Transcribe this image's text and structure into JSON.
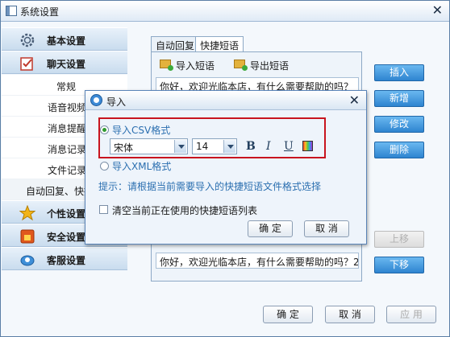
{
  "window": {
    "title": "系统设置"
  },
  "sidebar": {
    "categories": [
      {
        "label": "基本设置",
        "icon": "gear-icon"
      },
      {
        "label": "聊天设置",
        "icon": "chat-settings-icon"
      },
      {
        "label": "个性设置",
        "icon": "star-icon"
      },
      {
        "label": "安全设置",
        "icon": "shield-icon"
      },
      {
        "label": "客服设置",
        "icon": "customer-service-icon"
      }
    ],
    "sub_items": [
      "常规",
      "语音视频",
      "消息提醒",
      "消息记录",
      "文件记录",
      "自动回复、快捷短语"
    ]
  },
  "tabs": [
    {
      "label": "自动回复",
      "active": false
    },
    {
      "label": "快捷短语",
      "active": true
    }
  ],
  "toolbar": {
    "import_label": "导入短语",
    "export_label": "导出短语"
  },
  "phrases": [
    "你好，欢迎光临本店，有什么需要帮助的吗？",
    "你好，欢迎光临本店，有什么需要帮助的吗？2"
  ],
  "right_buttons": {
    "insert": "插入",
    "add": "新增",
    "edit": "修改",
    "delete": "删除",
    "move_up": "上移",
    "move_down": "下移"
  },
  "bottom_buttons": {
    "ok": "确 定",
    "cancel": "取 消",
    "apply": "应 用"
  },
  "dialog": {
    "title": "导入",
    "option_csv": "导入CSV格式",
    "option_xml": "导入XML格式",
    "font_name": "宋体",
    "font_size": "14",
    "format_bold": "B",
    "format_italic": "I",
    "format_underline": "U",
    "hint": "提示：请根据当前需要导入的快捷短语文件格式选择",
    "clear_label": "清空当前正在使用的快捷短语列表",
    "ok": "确 定",
    "cancel": "取 消"
  },
  "colors": {
    "accent_blue": "#2e84d0",
    "highlight_red": "#c8141e",
    "option_text": "#2b6fb0"
  }
}
